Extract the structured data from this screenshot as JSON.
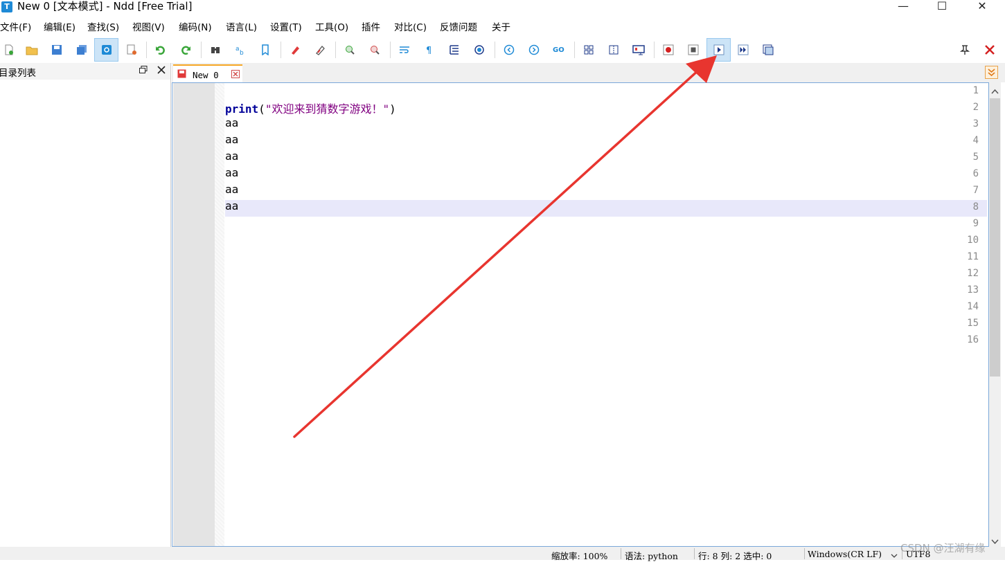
{
  "window": {
    "title": "New 0 [文本模式] - Ndd [Free Trial]",
    "app_icon": "T",
    "minimize": "—",
    "maximize": "☐",
    "close": "✕"
  },
  "menu": [
    "文件(F)",
    "编辑(E)",
    "查找(S)",
    "视图(V)",
    "编码(N)",
    "语言(L)",
    "设置(T)",
    "工具(O)",
    "插件",
    "对比(C)",
    "反馈问题",
    "关于"
  ],
  "sidebar": {
    "title": "目录列表"
  },
  "tab": {
    "label": "New 0"
  },
  "editor": {
    "line_numbers": [
      "1",
      "2",
      "3",
      "4",
      "5",
      "6",
      "7",
      "8",
      "9",
      "10",
      "11",
      "12",
      "13",
      "14",
      "15",
      "16"
    ],
    "code": {
      "keyword": "print",
      "paren_open": "(",
      "string": "\"欢迎来到猜数字游戏！\"",
      "paren_close": ")",
      "lines": [
        "aa",
        "aa",
        "aa",
        "aa",
        "aa",
        "aa"
      ]
    },
    "current_line": 8
  },
  "status": {
    "zoom": "缩放率: 100%",
    "syntax": "语法: python",
    "position": "行: 8  列: 2  选中: 0",
    "eol": "Windows(CR LF)",
    "encoding": "UTF8"
  },
  "watermark": "CSDN @汪湖有缘",
  "colors": {
    "accent": "#1e8ad6",
    "arrow": "#e8352f",
    "highlight": "#e8e8fa"
  }
}
